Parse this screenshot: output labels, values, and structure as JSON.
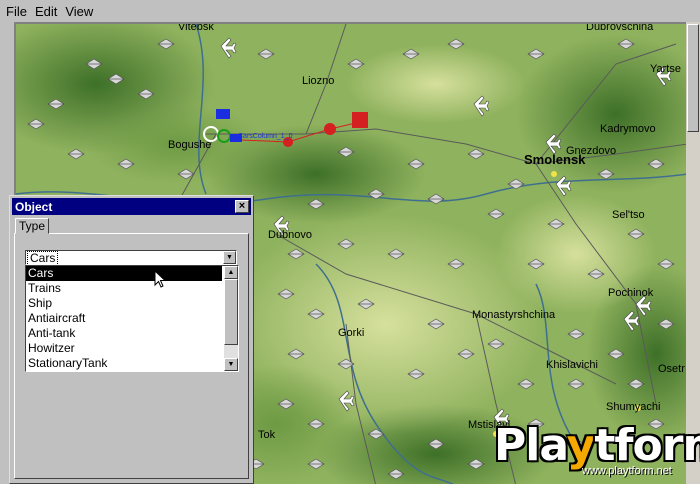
{
  "menu": [
    "File",
    "Edit",
    "View"
  ],
  "map": {
    "towns": [
      "Vitebsk",
      "Dubrovschina",
      "Liozno",
      "Yartse",
      "Bogushe",
      "Kadrymovo",
      "Smolensk",
      "Gnezdovo",
      "Sel'tso",
      "Dubnovo",
      "Pochinok",
      "Monastyrshchina",
      "Gorki",
      "Khislavichi",
      "Osetr",
      "Shumyachi",
      "Mstislavl",
      "Tok"
    ],
    "unit_label": "CarsColumn_1_0",
    "colors": {
      "terrain_dark": "#4a7a32",
      "terrain_light": "#c8d890",
      "road": "#5a5a5a",
      "river": "#3f6f8f",
      "unit_red": "#d42020",
      "unit_blue": "#1a2ee0"
    },
    "icons": [
      "airfield-icon",
      "aircraft-icon",
      "bridge-icon"
    ]
  },
  "dialog": {
    "title": "Object",
    "tab": "Type",
    "combo_value": "Cars",
    "list": [
      "Cars",
      "Trains",
      "Ship",
      "Antiaircraft",
      "Anti-tank",
      "Howitzer",
      "StationaryTank"
    ],
    "selected_index": 0
  },
  "watermark": {
    "logo_a": "Pla",
    "logo_y": "y",
    "logo_b": "tform",
    "url": "www.playtform.net"
  }
}
